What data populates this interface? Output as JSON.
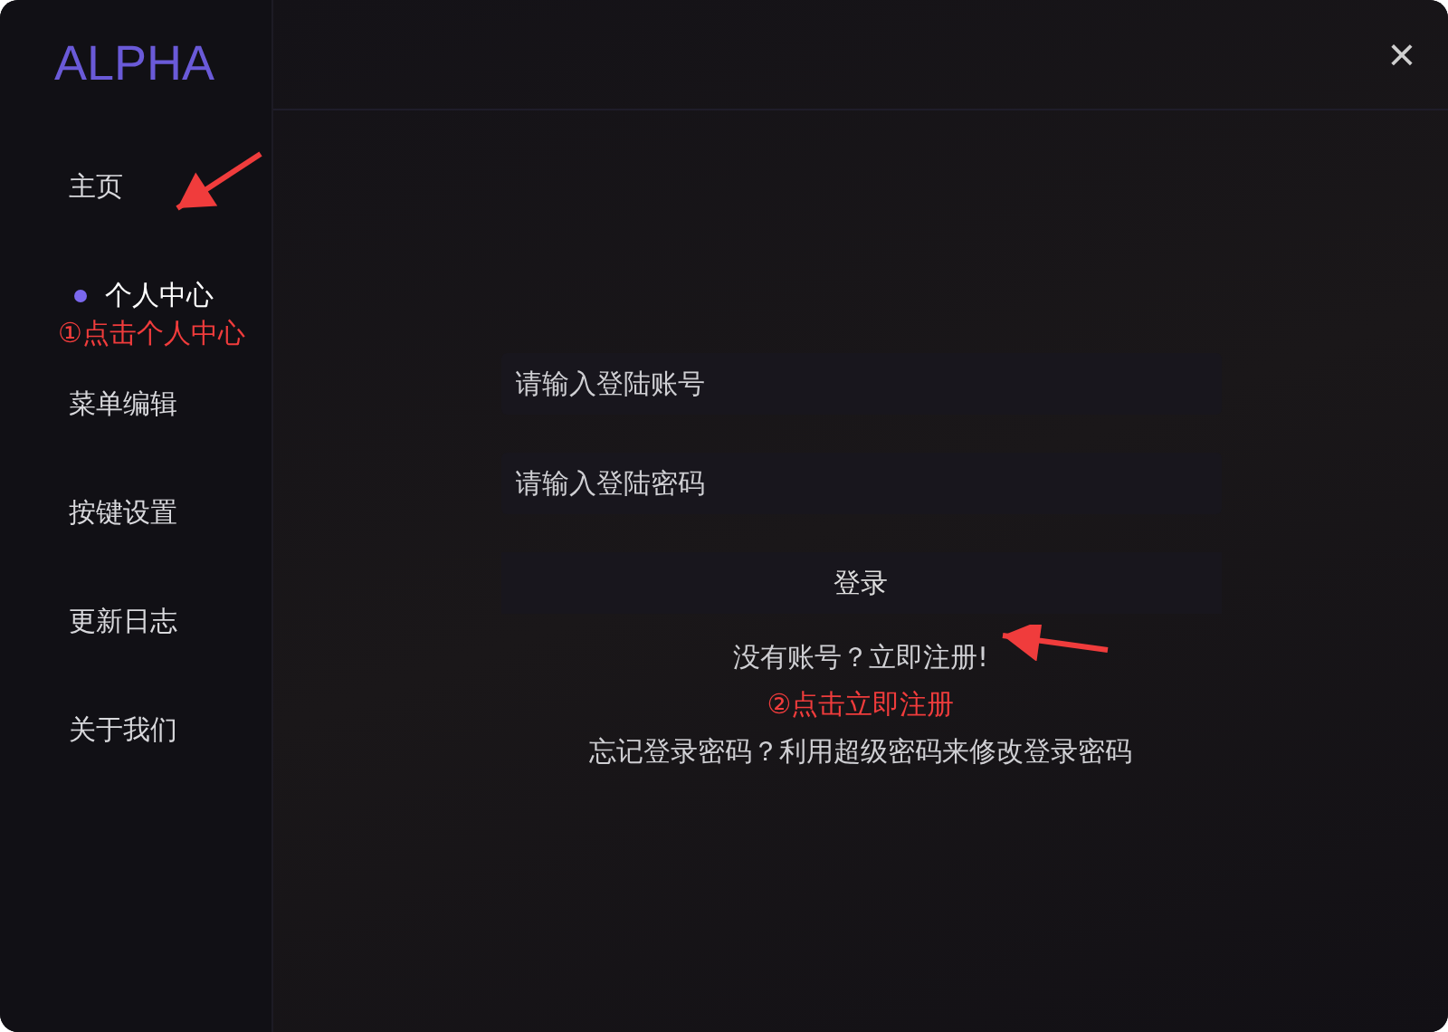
{
  "logo": "ALPHA",
  "close": "×",
  "sidebar": {
    "items": [
      {
        "label": "主页",
        "selected": false
      },
      {
        "label": "个人中心",
        "selected": true
      },
      {
        "label": "菜单编辑",
        "selected": false
      },
      {
        "label": "按键设置",
        "selected": false
      },
      {
        "label": "更新日志",
        "selected": false
      },
      {
        "label": "关于我们",
        "selected": false
      }
    ]
  },
  "annotations": [
    {
      "text": "①点击个人中心"
    },
    {
      "text": "②点击立即注册"
    }
  ],
  "form": {
    "fields": [
      {
        "placeholder": "请输入登陆账号"
      },
      {
        "placeholder": "请输入登陆密码"
      }
    ],
    "login_button": "登录",
    "register_link": "没有账号？立即注册!",
    "forgot_link": "忘记登录密码？利用超级密码来修改登录密码"
  }
}
